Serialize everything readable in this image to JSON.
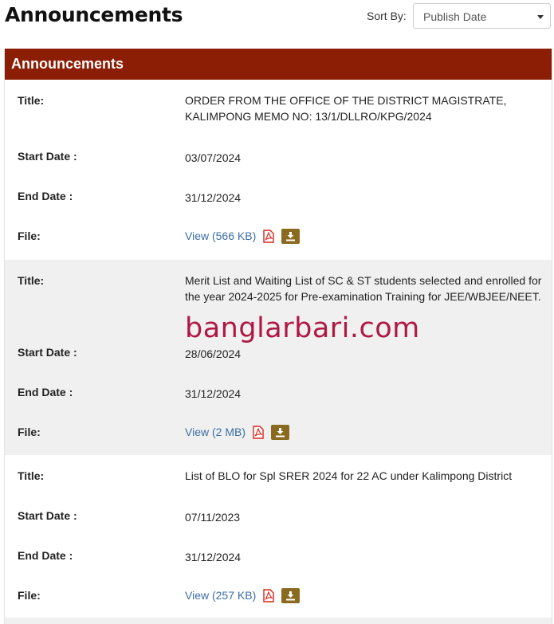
{
  "header": {
    "title": "Announcements",
    "sort_label": "Sort By:",
    "sort_value": "Publish Date"
  },
  "panel": {
    "title": "Announcements"
  },
  "labels": {
    "title": "Title:",
    "start_date": "Start Date :",
    "end_date": "End Date :",
    "file": "File:"
  },
  "announcements": [
    {
      "title": "ORDER FROM THE OFFICE OF THE DISTRICT MAGISTRATE, KALIMPONG MEMO NO: 13/1/DLLRO/KPG/2024",
      "start_date": "03/07/2024",
      "end_date": "31/12/2024",
      "file_link": "View (566 KB)"
    },
    {
      "title": "Merit List and Waiting List of SC & ST students selected and enrolled for the year 2024-2025 for Pre-examination Training for JEE/WBJEE/NEET.",
      "start_date": "28/06/2024",
      "end_date": "31/12/2024",
      "file_link": "View (2 MB)"
    },
    {
      "title": "List of BLO for Spl SRER 2024 for 22 AC under Kalimpong District",
      "start_date": "07/11/2023",
      "end_date": "31/12/2024",
      "file_link": "View (257 KB)"
    }
  ],
  "watermark": "banglarbari.com",
  "colors": {
    "panel_header": "#8b1e05",
    "link": "#3a6ea5",
    "pdf_icon": "#d9261c",
    "download_button": "#8a6a1e",
    "watermark": "#b01844",
    "alt_row": "#f0f0f0"
  }
}
